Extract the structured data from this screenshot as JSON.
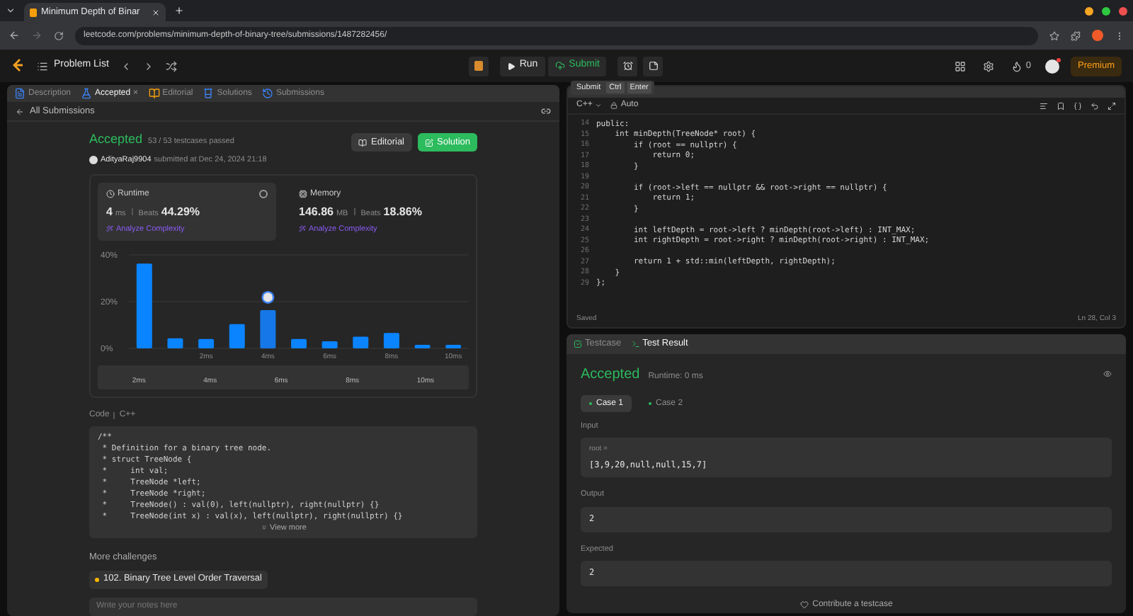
{
  "browser": {
    "tab_title": "Minimum Depth of Binar",
    "url": "leetcode.com/problems/minimum-depth-of-binary-tree/submissions/1487282456/"
  },
  "navbar": {
    "problem_list": "Problem List",
    "run": "Run",
    "submit": "Submit",
    "streak": "0",
    "premium": "Premium"
  },
  "tooltip": {
    "label": "Submit",
    "keys": [
      "Ctrl",
      "Enter"
    ]
  },
  "left_tabs": [
    {
      "label": "Description",
      "selected": false,
      "kind": "description"
    },
    {
      "label": "Accepted",
      "selected": true,
      "kind": "result",
      "close": "×"
    },
    {
      "label": "Editorial",
      "selected": false,
      "kind": "editorial"
    },
    {
      "label": "Solutions",
      "selected": false,
      "kind": "solutions"
    },
    {
      "label": "Submissions",
      "selected": false,
      "kind": "submissions"
    }
  ],
  "submission": {
    "back": "All Submissions",
    "status": "Accepted",
    "passed": "53 / 53 testcases passed",
    "user": "AdityaRaj9904",
    "submitted_at": "submitted at Dec 24, 2024 21:18",
    "editorial_button": "Editorial",
    "solution_button": "Solution"
  },
  "stats": [
    {
      "kind": "runtime",
      "title": "Runtime",
      "value": "4",
      "unit": "ms",
      "beats_label": "Beats",
      "beats": "44.29%",
      "analyze": "Analyze Complexity",
      "selected": true
    },
    {
      "kind": "memory",
      "title": "Memory",
      "value": "146.86",
      "unit": "MB",
      "beats_label": "Beats",
      "beats": "18.86%",
      "analyze": "Analyze Complexity",
      "selected": false
    }
  ],
  "chart_data": {
    "type": "bar",
    "x": [
      0,
      1,
      2,
      3,
      4,
      5,
      6,
      7,
      8,
      9,
      10
    ],
    "values": [
      36.3,
      4.3,
      4,
      10.4,
      16.4,
      4,
      3,
      5,
      6.6,
      1.5,
      1.5
    ],
    "xlim": [
      -0.5,
      10.5
    ],
    "ylim": [
      0,
      40
    ],
    "yticks": [
      {
        "value": 0,
        "label": "0%"
      },
      {
        "value": 20,
        "label": "20%"
      },
      {
        "value": 40,
        "label": "40%"
      }
    ],
    "xticks": [
      {
        "value": 2,
        "label": "2ms"
      },
      {
        "value": 4,
        "label": "4ms"
      },
      {
        "value": 6,
        "label": "6ms"
      },
      {
        "value": 8,
        "label": "8ms"
      },
      {
        "value": 10,
        "label": "10ms"
      }
    ]
  },
  "histogram_bars": [
    {
      "selected": false
    },
    {
      "selected": false
    },
    {
      "selected": false
    },
    {
      "selected": false
    },
    {
      "selected": true
    },
    {
      "selected": false
    },
    {
      "selected": false
    },
    {
      "selected": false
    },
    {
      "selected": false
    },
    {
      "selected": false
    },
    {
      "selected": false
    }
  ],
  "minimap_labels": [
    "2ms",
    "4ms",
    "6ms",
    "8ms",
    "10ms"
  ],
  "code_section": {
    "label": "Code",
    "language": "C++",
    "view_more": "View more",
    "lines": [
      "/**",
      " * Definition for a binary tree node.",
      " * struct TreeNode {",
      " *     int val;",
      " *     TreeNode *left;",
      " *     TreeNode *right;",
      " *     TreeNode() : val(0), left(nullptr), right(nullptr) {}",
      " *     TreeNode(int x) : val(x), left(nullptr), right(nullptr) {}"
    ]
  },
  "more_challenges": {
    "title": "More challenges",
    "items": [
      "102. Binary Tree Level Order Traversal"
    ]
  },
  "notes": {
    "placeholder": "Write your notes here"
  },
  "editor": {
    "language": "C++",
    "mode": "Auto",
    "status": "Saved",
    "position": "Ln 28, Col 3",
    "lines": [
      {
        "number": "14",
        "code": "public:"
      },
      {
        "number": "15",
        "code": "    int minDepth(TreeNode* root) {"
      },
      {
        "number": "16",
        "code": "        if (root == nullptr) {"
      },
      {
        "number": "17",
        "code": "            return 0;"
      },
      {
        "number": "18",
        "code": "        }"
      },
      {
        "number": "19"
      },
      {
        "number": "20",
        "code": "        if (root->left == nullptr && root->right == nullptr) {"
      },
      {
        "number": "21",
        "code": "            return 1;"
      },
      {
        "number": "22",
        "code": "        }"
      },
      {
        "number": "23"
      },
      {
        "number": "24",
        "code": "        int leftDepth = root->left ? minDepth(root->left) : INT_MAX;"
      },
      {
        "number": "25",
        "code": "        int rightDepth = root->right ? minDepth(root->right) : INT_MAX;"
      },
      {
        "number": "26"
      },
      {
        "number": "27",
        "code": "        return 1 + std::min(leftDepth, rightDepth);"
      },
      {
        "number": "28",
        "code": "    }"
      },
      {
        "number": "29",
        "code": "};"
      }
    ]
  },
  "test_panel": {
    "tabs": [
      {
        "label": "Testcase",
        "selected": false
      },
      {
        "label": "Test Result",
        "selected": true
      }
    ],
    "status": "Accepted",
    "runtime": "Runtime: 0 ms",
    "cases": [
      {
        "label": "Case 1",
        "selected": true
      },
      {
        "label": "Case 2",
        "selected": false
      }
    ],
    "input_label": "Input",
    "input_name": "root =",
    "input_value": "[3,9,20,null,null,15,7]",
    "output_label": "Output",
    "output_value": "2",
    "expected_label": "Expected",
    "expected_value": "2",
    "contribute": "Contribute a testcase"
  }
}
